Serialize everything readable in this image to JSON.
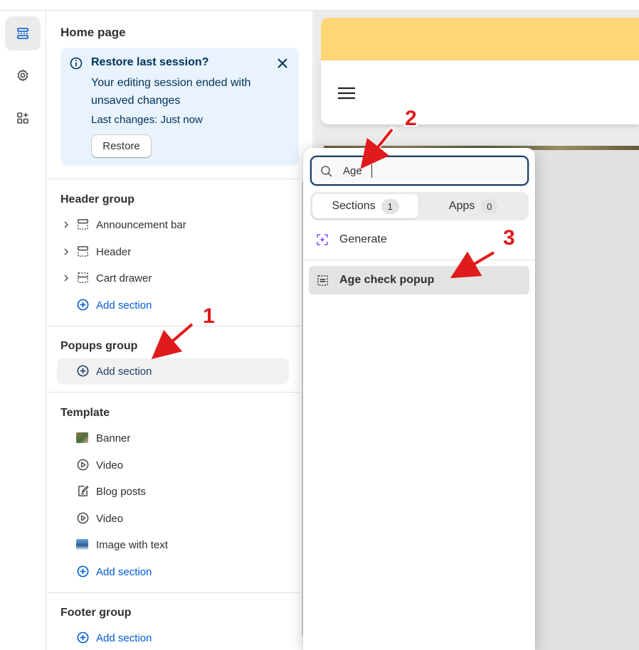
{
  "sidebar": {
    "page_title": "Home page",
    "banner": {
      "title": "Restore last session?",
      "message": "Your editing session ended with unsaved changes",
      "last_changes": "Last changes: Just now",
      "restore_label": "Restore"
    },
    "header_group": {
      "title": "Header group",
      "items": [
        {
          "label": "Announcement bar",
          "icon": "section-icon"
        },
        {
          "label": "Header",
          "icon": "section-icon"
        },
        {
          "label": "Cart drawer",
          "icon": "section-icon"
        }
      ],
      "add_label": "Add section"
    },
    "popups_group": {
      "title": "Popups group",
      "add_label": "Add section"
    },
    "template": {
      "title": "Template",
      "items": [
        {
          "label": "Banner",
          "icon": "image-thumbnail"
        },
        {
          "label": "Video",
          "icon": "play-circle-icon"
        },
        {
          "label": "Blog posts",
          "icon": "edit-document-icon"
        },
        {
          "label": "Video",
          "icon": "play-circle-icon"
        },
        {
          "label": "Image with text",
          "icon": "image-thumbnail"
        }
      ],
      "add_label": "Add section"
    },
    "footer_group": {
      "title": "Footer group",
      "add_label": "Add section"
    }
  },
  "popover": {
    "search_value": "Age",
    "tabs": [
      {
        "label": "Sections",
        "count": "1"
      },
      {
        "label": "Apps",
        "count": "0"
      }
    ],
    "generate_label": "Generate",
    "result_label": "Age check popup"
  },
  "annotations": [
    "1",
    "2",
    "3"
  ],
  "colors": {
    "accent_blue": "#005bd3",
    "banner_bg": "#e8f3fd",
    "annotation_red": "#e01b1b",
    "preview_yellow": "#ffd777",
    "generate_purple": "#8051ff"
  }
}
